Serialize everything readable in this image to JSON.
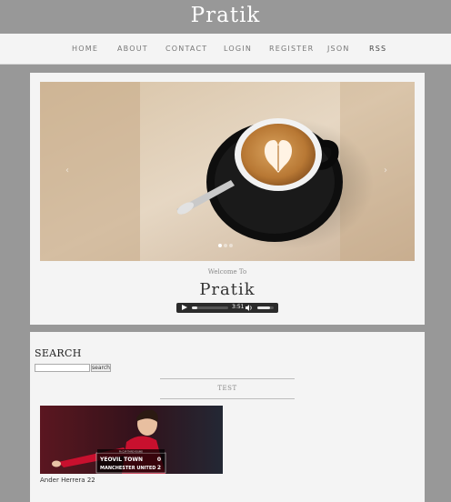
{
  "header": {
    "brand": "Pratik"
  },
  "nav": {
    "items": [
      {
        "label": "HOME"
      },
      {
        "label": "ABOUT"
      },
      {
        "label": "CONTACT"
      },
      {
        "label": "LOGIN"
      },
      {
        "label": "REGISTER"
      },
      {
        "label": "JSON"
      },
      {
        "label": "RSS"
      }
    ]
  },
  "hero": {
    "image_subject": "coffee cup latte art",
    "arrows": {
      "prev": "‹",
      "next": "›"
    },
    "welcome": "Welcome To",
    "title": "Pratik"
  },
  "player": {
    "time": "3:51",
    "progress_fraction": 0.15,
    "volume_fraction": 0.8
  },
  "sidebar": {
    "search_title": "SEARCH",
    "search_value": "",
    "search_button": "search",
    "section_label": "TEST",
    "post": {
      "caption": "Ander Herrera 22",
      "image_text": {
        "top": "FA CUP THIRD ROUND",
        "home": "YEOVIL TOWN",
        "away": "MANCHESTER UNITED",
        "score_home": "0",
        "score_away": "2"
      }
    }
  },
  "colors": {
    "page_bg": "#989898",
    "card_bg": "#f4f4f4",
    "accent_dark": "#2b2b2b"
  }
}
